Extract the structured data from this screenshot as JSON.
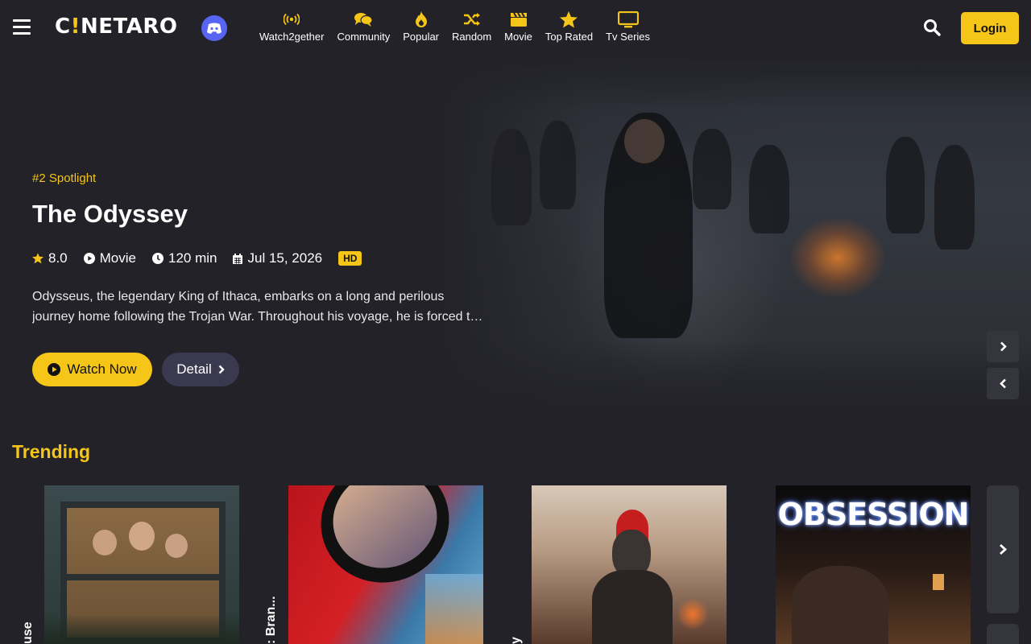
{
  "header": {
    "logo_prefix": "C",
    "logo_bang": "!",
    "logo_suffix": "NETARO",
    "login_label": "Login",
    "nav": [
      {
        "label": "Watch2gether",
        "icon": "broadcast-icon"
      },
      {
        "label": "Community",
        "icon": "comments-icon"
      },
      {
        "label": "Popular",
        "icon": "fire-icon"
      },
      {
        "label": "Random",
        "icon": "shuffle-icon"
      },
      {
        "label": "Movie",
        "icon": "clapperboard-icon"
      },
      {
        "label": "Top Rated",
        "icon": "star-icon"
      },
      {
        "label": "Tv Series",
        "icon": "tv-icon"
      }
    ]
  },
  "hero": {
    "spotlight": "#2 Spotlight",
    "title": "The Odyssey",
    "rating": "8.0",
    "type": "Movie",
    "duration": "120 min",
    "date": "Jul 15, 2026",
    "quality": "HD",
    "description_line1": "Odysseus, the legendary King of Ithaca, embarks on a long and perilous",
    "description_line2": "journey home following the Trojan War. Throughout his voyage, he is forced to confront",
    "watch_label": "Watch Now",
    "detail_label": "Detail"
  },
  "trending": {
    "title": "Trending",
    "items": [
      {
        "label": "use",
        "poster": "family-window-poster"
      },
      {
        "label": ": Bran...",
        "poster": "spider-man-poster"
      },
      {
        "label": "y",
        "poster": "gladiator-poster"
      },
      {
        "label": "OBSESSION",
        "poster": "obsession-poster"
      }
    ]
  },
  "colors": {
    "background": "#222228",
    "accent": "#f5c518",
    "discord": "#5865f2",
    "detail_button": "#3a3950"
  }
}
